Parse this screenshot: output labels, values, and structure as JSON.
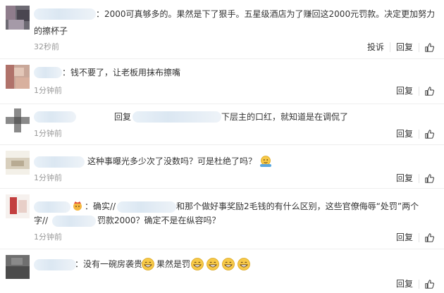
{
  "comments": [
    {
      "text_1": "：2000可真够多的。果然是下了狠手。五星级酒店为了赚回这2000元罚款。决定更加努力",
      "text_2": "的擦杯子",
      "time": "32秒前",
      "report_label": "投诉",
      "reply_label": "回复",
      "like_icon": "thumbs-up-icon"
    },
    {
      "text_1": "：钱不要了，让老板用抹布擦嘴",
      "time": "1分钟前",
      "reply_label": "回复",
      "like_icon": "thumbs-up-icon"
    },
    {
      "prefix": "回复",
      "text_1": "下层主的口红，就知道是在调侃了",
      "time": "1分钟前",
      "reply_label": "回复",
      "like_icon": "thumbs-up-icon"
    },
    {
      "text_1": "这种事曝光多少次了没数吗？可是杜绝了吗？",
      "emoji": "shrug-emoji",
      "time": "1分钟前",
      "reply_label": "回复",
      "like_icon": "thumbs-up-icon"
    },
    {
      "crown_icon": "crown-emoji",
      "text_a": "：确实//",
      "text_b": "和那个做好事奖励2毛钱的有什么区别，这些官僚侮辱“处罚”两个",
      "text_c": "字//",
      "text_d": "罚款2000？确定不是在纵容吗？",
      "time": "1分钟前",
      "reply_label": "回复",
      "like_icon": "thumbs-up-icon"
    },
    {
      "text_a": "：没有一碗房袭贵",
      "text_b": "果然是罚",
      "emoji": "grin-emoji",
      "reply_label": "回复",
      "like_icon": "thumbs-up-icon"
    }
  ]
}
